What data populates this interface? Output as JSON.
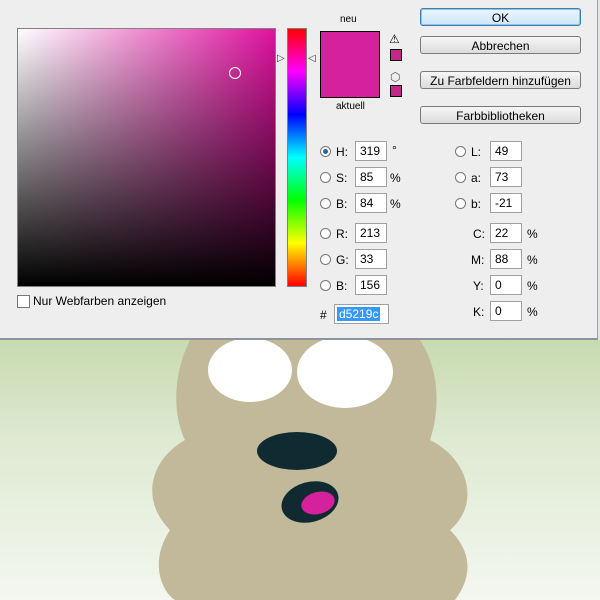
{
  "dialog": {
    "preview_new_label": "neu",
    "preview_current_label": "aktuell",
    "new_color": "#d5219c",
    "current_color": "#d5219c",
    "buttons": {
      "ok": "OK",
      "cancel": "Abbrechen",
      "add_swatches": "Zu Farbfeldern hinzufügen",
      "libraries": "Farbbibliotheken"
    },
    "hsb": {
      "h_label": "H:",
      "h_value": "319",
      "h_unit": "°",
      "s_label": "S:",
      "s_value": "85",
      "s_unit": "%",
      "b_label": "B:",
      "b_value": "84",
      "b_unit": "%"
    },
    "rgb": {
      "r_label": "R:",
      "r_value": "213",
      "g_label": "G:",
      "g_value": "33",
      "b_label": "B:",
      "b_value": "156"
    },
    "lab": {
      "l_label": "L:",
      "l_value": "49",
      "a_label": "a:",
      "a_value": "73",
      "b_label": "b:",
      "b_value": "-21"
    },
    "cmyk": {
      "c_label": "C:",
      "c_value": "22",
      "c_unit": "%",
      "m_label": "M:",
      "m_value": "88",
      "m_unit": "%",
      "y_label": "Y:",
      "y_value": "0",
      "y_unit": "%",
      "k_label": "K:",
      "k_value": "0",
      "k_unit": "%"
    },
    "hex_label": "#",
    "hex_value": "d5219c",
    "web_colors_label": "Nur Webfarben anzeigen",
    "selected_mode": "H"
  },
  "colors": {
    "field_hue": "#e0119e",
    "canvas_tan": "#c2b99a",
    "eye_white": "#ffffff",
    "nose": "#0f2a30",
    "mouth": "#0f2a30",
    "tongue": "#d5219c"
  }
}
